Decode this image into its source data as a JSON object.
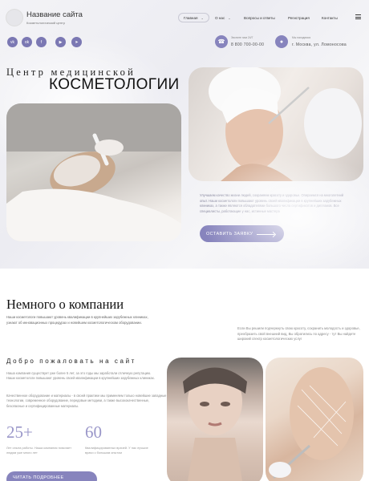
{
  "header": {
    "site_title": "Название сайта",
    "site_subtitle": "Косметологический центр",
    "nav": [
      {
        "label": "Главная",
        "has_dropdown": true
      },
      {
        "label": "О нас",
        "has_dropdown": true
      },
      {
        "label": "Вопросы и ответы",
        "has_dropdown": false
      },
      {
        "label": "Регистрация",
        "has_dropdown": false
      },
      {
        "label": "Контакты",
        "has_dropdown": false
      }
    ],
    "social_icons": [
      "vk-icon",
      "odnoklassniki-icon",
      "facebook-icon",
      "youtube-icon",
      "telegram-icon"
    ],
    "phone": {
      "label": "Звоните нам 24/7",
      "value": "8 800 700-00-00"
    },
    "address": {
      "label": "Мы находимся",
      "value": "г. Москва, ул. Ломоносова"
    }
  },
  "hero": {
    "title_line1": "Центр медицинской",
    "title_line2": "КОСМЕТОЛОГИИ",
    "description": "Улучшаем качество жизни людей, сохраняем красоту и здоровье. Опираемся на многолетний опыт. Наши косметологи повышают уровень своей квалификации в крупнейших зарубежных клиниках, а также являются обладателями большого числа сертификатов и дипломов. Все специалисты, работающие у нас, истинные мастера",
    "button_label": "ОСТАВИТЬ ЗАЯВКУ"
  },
  "about": {
    "title": "Немного о компании",
    "text_left": "Наши косметологи повышают уровень квалификации в крупнейших зарубежных клиниках, узнают об инновационных процедурах и новейшем косметологическом оборудовании.",
    "text_right": "Если Вы решили подчеркнуть свою красоту, сохранить молодость и здоровье, преобразить свой внешний вид, Вы обратились по адресу - тут Вы найдете широкий спектр косметологических услуг",
    "welcome_title": "Добро пожаловать на сайт",
    "welcome_p1": "Наша компания существует уже более 5 лет, за это годы мы заработали отличную репутацию. Наши косметологи повышают уровень своей квалификации в крупнейших зарубежных клиниках.",
    "welcome_p2": "Качественное оборудование и материалы - в своей практике мы применяем только новейшие западные технологии, современное оборудование, передовые методики, а также высококачественные, безопасные и сертифицированные материалы.",
    "stats": [
      {
        "value": "25+",
        "label": "Лет опыта работы. Наша компания помогает людям уже много лет"
      },
      {
        "value": "60",
        "label": "Квалифицированных врачей. У нас лучшие врачи с большим опытом"
      }
    ],
    "more_button_label": "ЧИТАТЬ ПОДРОБНЕЕ"
  },
  "colors": {
    "accent": "#8784bd",
    "stat_number": "#9a97c9"
  }
}
